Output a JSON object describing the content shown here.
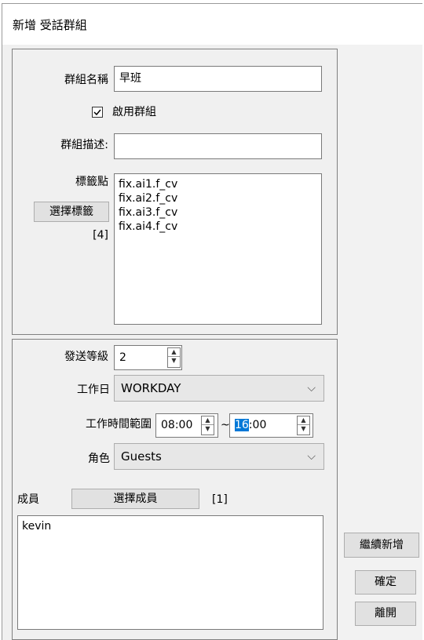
{
  "window": {
    "title": "新增 受話群組"
  },
  "group": {
    "name_label": "群組名稱",
    "name_value": "早班",
    "enable_label": "啟用群組",
    "enabled": true,
    "desc_label": "群組描述:",
    "desc_value": "",
    "tags_label": "標籤點",
    "select_tags_button": "選擇標籤",
    "tag_count": "[4]",
    "tags": [
      "fix.ai1.f_cv",
      "fix.ai2.f_cv",
      "fix.ai3.f_cv",
      "fix.ai4.f_cv"
    ]
  },
  "settings": {
    "level_label": "發送等級",
    "level_value": "2",
    "workday_label": "工作日",
    "workday_value": "WORKDAY",
    "time_label": "工作時間範圍",
    "time_start": "08:00",
    "time_sep": "~",
    "time_end_selected": "16",
    "time_end_rest": ":00",
    "role_label": "角色",
    "role_value": "Guests"
  },
  "members": {
    "label": "成員",
    "select_button": "選擇成員",
    "count": "[1]",
    "items": [
      "kevin"
    ]
  },
  "actions": {
    "continue_add": "繼續新增",
    "confirm": "確定",
    "leave": "離開"
  }
}
